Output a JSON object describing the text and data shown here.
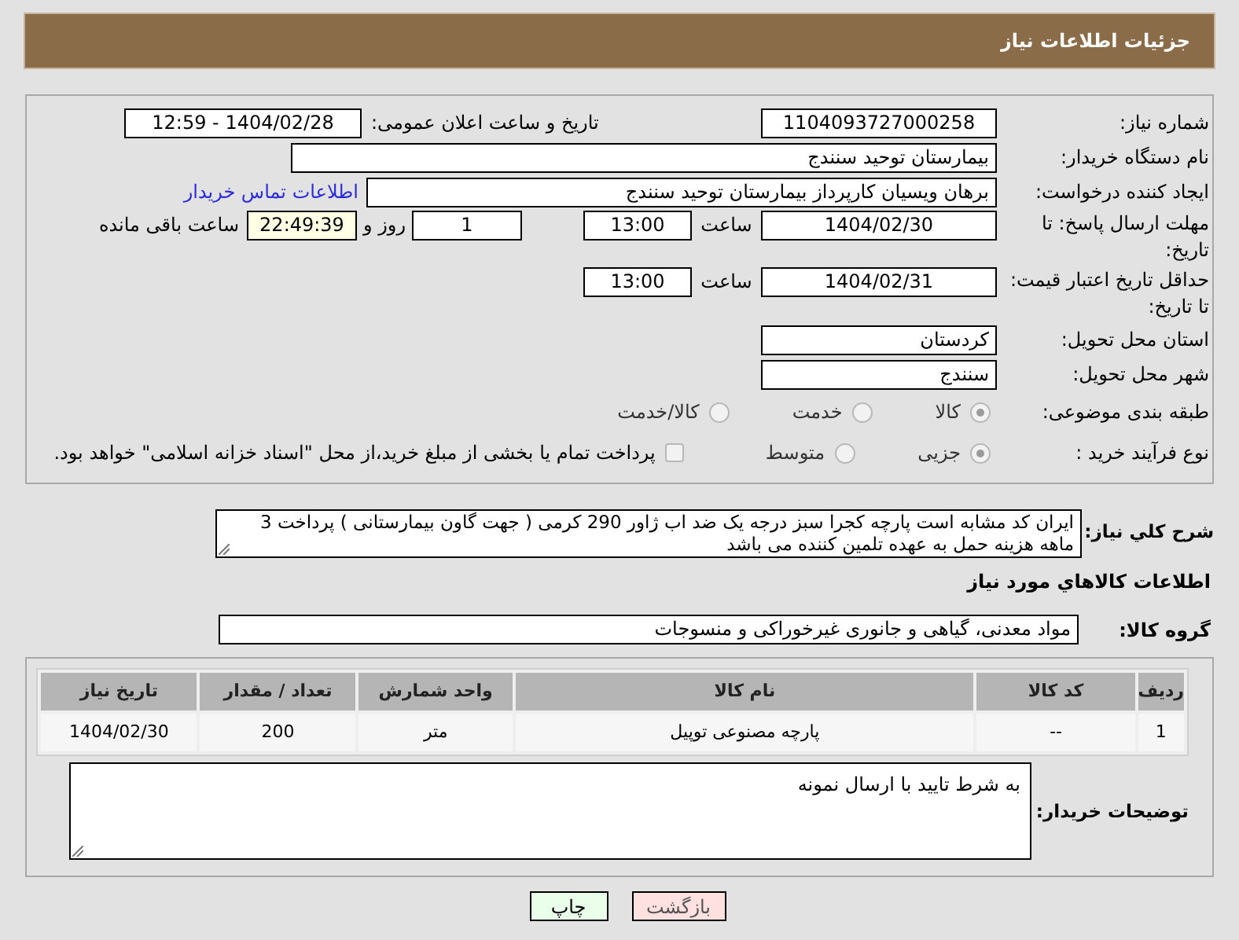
{
  "header": {
    "title": "جزئیات اطلاعات نیاز"
  },
  "need_number": {
    "label": "شماره نیاز:",
    "value": "1104093727000258"
  },
  "announce": {
    "label": "تاریخ و ساعت اعلان عمومی:",
    "value": "1404/02/28 - 12:59"
  },
  "buyer_org": {
    "label": "نام دستگاه خریدار:",
    "value": "بیمارستان توحید سنندج"
  },
  "requester": {
    "label": "ایجاد کننده درخواست:",
    "value": "برهان ویسیان کارپرداز بیمارستان توحید سنندج",
    "link": "اطلاعات تماس خریدار"
  },
  "response_deadline": {
    "label": "مهلت ارسال پاسخ: تا تاریخ:",
    "date": "1404/02/30",
    "time_label": "ساعت",
    "time": "13:00",
    "days": "1",
    "days_label": "روز و",
    "remaining": "22:49:39",
    "remaining_label": "ساعت باقی مانده"
  },
  "price_validity": {
    "label": "حداقل تاریخ اعتبار قیمت: تا تاریخ:",
    "date": "1404/02/31",
    "time_label": "ساعت",
    "time": "13:00"
  },
  "province": {
    "label": "استان محل تحویل:",
    "value": "کردستان"
  },
  "city": {
    "label": "شهر محل تحویل:",
    "value": "سنندج"
  },
  "category": {
    "label": "طبقه بندی موضوعی:",
    "options": [
      {
        "label": "کالا",
        "selected": true
      },
      {
        "label": "خدمت",
        "selected": false
      },
      {
        "label": "کالا/خدمت",
        "selected": false
      }
    ]
  },
  "process": {
    "label": "نوع فرآیند خرید :",
    "options": [
      {
        "label": "جزیی",
        "selected": true
      },
      {
        "label": "متوسط",
        "selected": false
      }
    ],
    "treasury": {
      "checked": false,
      "text": "پرداخت تمام یا بخشی از مبلغ خرید،از محل \"اسناد خزانه اسلامی\" خواهد بود."
    }
  },
  "description": {
    "label": "شرح کلي نياز:",
    "value": "ایران کد مشابه است پارچه کجرا سبز درجه یک ضد اب ژاور 290 کرمی ( جهت گاون بیمارستانی ) پرداخت  3 ماهه هزینه حمل به عهده تلمین کننده می باشد"
  },
  "goods_title": "اطلاعات کالاهاي مورد نياز",
  "goods_group": {
    "label": "گروه کالا:",
    "value": "مواد معدنی، گیاهی و جانوری غیرخوراکی و منسوجات"
  },
  "table": {
    "columns": [
      "ردیف",
      "کد کالا",
      "نام کالا",
      "واحد شمارش",
      "تعداد / مقدار",
      "تاریخ نیاز"
    ],
    "rows": [
      [
        "1",
        "--",
        "پارچه مصنوعی توپیل",
        "متر",
        "200",
        "1404/02/30"
      ]
    ]
  },
  "buyer_notes": {
    "label": "توضیحات خریدار:",
    "value": "به شرط تایید با ارسال نمونه"
  },
  "buttons": [
    {
      "label": "بازگشت",
      "kind": "back"
    },
    {
      "label": "چاپ",
      "kind": "print"
    }
  ]
}
